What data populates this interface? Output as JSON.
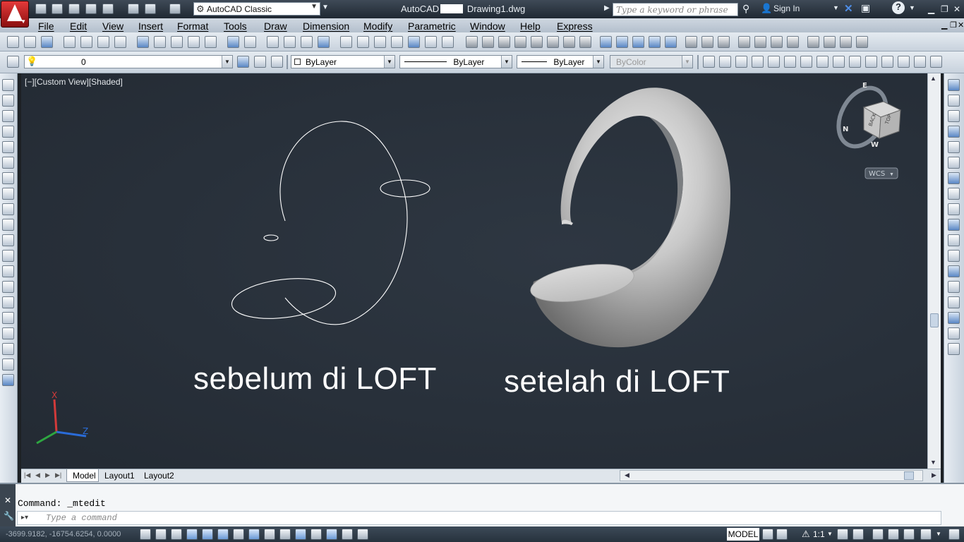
{
  "title_bar": {
    "workspace": "AutoCAD Classic",
    "app_name": "AutoCAD",
    "document": "Drawing1.dwg",
    "search_placeholder": "Type a keyword or phrase",
    "sign_in": "Sign In"
  },
  "menu": [
    "File",
    "Edit",
    "View",
    "Insert",
    "Format",
    "Tools",
    "Draw",
    "Dimension",
    "Modify",
    "Parametric",
    "Window",
    "Help",
    "Express"
  ],
  "properties_bar": {
    "layer": "0",
    "color": "ByLayer",
    "linetype": "ByLayer",
    "lineweight": "ByLayer",
    "plotstyle": "ByColor"
  },
  "viewport": {
    "label": "[−][Custom View][Shaded]",
    "caption_before": "sebelum di LOFT",
    "caption_after": "setelah di LOFT",
    "viewcube_face": "BACK",
    "viewcube_face2": "TOP",
    "compass": {
      "north": "N",
      "east": "E",
      "west": "W"
    },
    "wcs": "WCS",
    "ucs": {
      "x": "X",
      "z": "Z"
    }
  },
  "layout_tabs": [
    "Model",
    "Layout1",
    "Layout2"
  ],
  "command": {
    "history": "Command: _mtedit",
    "placeholder": "Type a command"
  },
  "status_bar": {
    "coordinates": "-3699.9182, -16754.6254, 0.0000",
    "space": "MODEL",
    "scale": "1:1"
  },
  "colors": {
    "viewport_bg": "#2a323c",
    "curve": "#ffffff",
    "title_bar": "#2b3541"
  }
}
